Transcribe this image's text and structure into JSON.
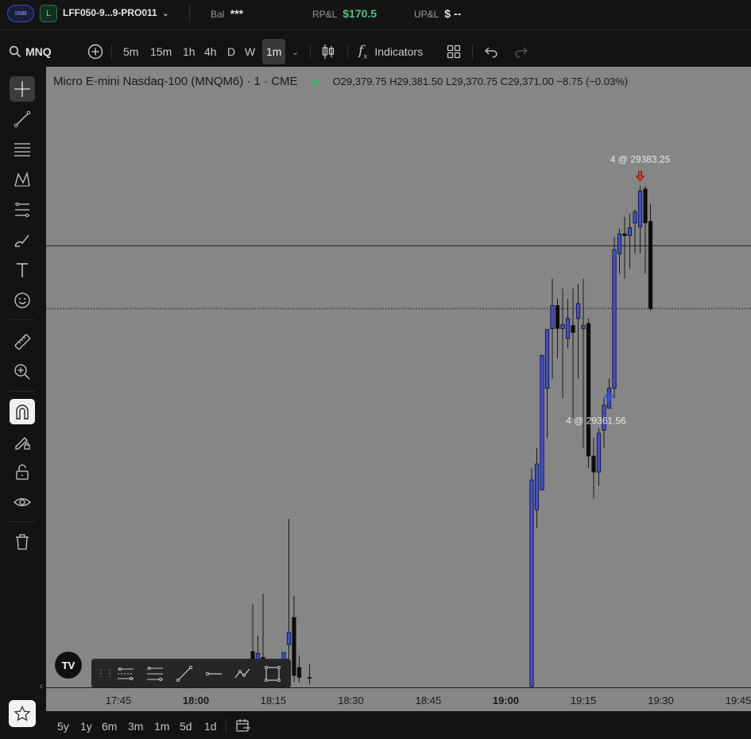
{
  "topbar": {
    "logo_text": "SMB",
    "account_badge": "L",
    "account_name": "LFF050-9...9-PRO011",
    "bal_label": "Bal",
    "bal_value": "***",
    "rpl_label": "RP&L",
    "rpl_value": "$170.5",
    "upl_label": "UP&L",
    "upl_value": "$ --",
    "colors": {
      "positive": "#4fc48a",
      "accent": "#3a4cc8"
    }
  },
  "toolbar": {
    "symbol": "MNQ",
    "intervals": [
      "5m",
      "15m",
      "1h",
      "4h",
      "D",
      "W",
      "1m"
    ],
    "active_interval": "1m",
    "indicators_label": "Indicators"
  },
  "chart": {
    "title": "Micro E-mini Nasdaq-100 (MNQM6) · 1 · CME",
    "ohlc": "O29,379.75  H29,381.50  L29,370.75  C29,371.00  −8.75 (−0.03%)",
    "sell_marker_label": "4 @ 29383.25",
    "buy_marker_label": "4 @ 29361.56",
    "colors": {
      "background": "#868686",
      "up": "#3d4fd8",
      "down": "#0d0d0d",
      "sell_marker": "#d23a3a",
      "buy_marker": "#3d4fd8"
    }
  },
  "chart_data": {
    "type": "candlestick",
    "x_tick_labels": [
      "17:45",
      "18:00",
      "18:15",
      "18:30",
      "18:45",
      "19:00",
      "19:15",
      "19:30",
      "19:45"
    ],
    "bold_ticks": [
      "18:00",
      "19:00"
    ],
    "candles": [
      {
        "t": "18:11",
        "o": 29336.6,
        "h": 29341.3,
        "l": 29333.5,
        "c": 29334.8
      },
      {
        "t": "18:12",
        "o": 29335.0,
        "h": 29338.2,
        "l": 29333.5,
        "c": 29336.4
      },
      {
        "t": "18:13",
        "o": 29336.0,
        "h": 29342.4,
        "l": 29333.5,
        "c": 29334.7
      },
      {
        "t": "18:14",
        "o": 29334.7,
        "h": 29335.3,
        "l": 29333.5,
        "c": 29334.0
      },
      {
        "t": "18:17",
        "o": 29333.2,
        "h": 29336.5,
        "l": 29333.0,
        "c": 29336.5
      },
      {
        "t": "18:18",
        "o": 29337.3,
        "h": 29349.9,
        "l": 29333.5,
        "c": 29338.5
      },
      {
        "t": "18:19",
        "o": 29340.0,
        "h": 29342.2,
        "l": 29333.5,
        "c": 29334.2
      },
      {
        "t": "18:20",
        "o": 29335.0,
        "h": 29336.2,
        "l": 29333.5,
        "c": 29334.0
      },
      {
        "t": "18:22",
        "o": 29334.0,
        "h": 29335.3,
        "l": 29333.3,
        "c": 29334.0
      },
      {
        "t": "19:05",
        "o": 29333.1,
        "h": 29355.0,
        "l": 29333.0,
        "c": 29353.8
      },
      {
        "t": "19:06",
        "o": 29350.8,
        "h": 29357.0,
        "l": 29349.0,
        "c": 29355.4
      },
      {
        "t": "19:07",
        "o": 29352.8,
        "h": 29366.3,
        "l": 29352.8,
        "c": 29366.3
      },
      {
        "t": "19:08",
        "o": 29363.0,
        "h": 29368.0,
        "l": 29358.0,
        "c": 29368.9
      },
      {
        "t": "19:09",
        "o": 29369.0,
        "h": 29374.0,
        "l": 29364.0,
        "c": 29371.3
      },
      {
        "t": "19:10",
        "o": 29371.3,
        "h": 29372.0,
        "l": 29366.0,
        "c": 29369.0
      },
      {
        "t": "19:11",
        "o": 29369.0,
        "h": 29373.0,
        "l": 29362.0,
        "c": 29369.4
      },
      {
        "t": "19:12",
        "o": 29368.0,
        "h": 29372.0,
        "l": 29367.0,
        "c": 29370.0
      },
      {
        "t": "19:13",
        "o": 29369.3,
        "h": 29373.0,
        "l": 29360.0,
        "c": 29368.6
      },
      {
        "t": "19:14",
        "o": 29370.0,
        "h": 29373.5,
        "l": 29364.0,
        "c": 29371.5
      },
      {
        "t": "19:15",
        "o": 29369.0,
        "h": 29374.0,
        "l": 29357.0,
        "c": 29369.3
      },
      {
        "t": "19:16",
        "o": 29369.5,
        "h": 29370.0,
        "l": 29355.0,
        "c": 29356.2
      },
      {
        "t": "19:17",
        "o": 29356.2,
        "h": 29358.0,
        "l": 29352.0,
        "c": 29354.6
      },
      {
        "t": "19:18",
        "o": 29354.6,
        "h": 29359.0,
        "l": 29353.2,
        "c": 29358.5
      },
      {
        "t": "19:19",
        "o": 29358.8,
        "h": 29362.0,
        "l": 29357.0,
        "c": 29361.3
      },
      {
        "t": "19:20",
        "o": 29361.0,
        "h": 29364.0,
        "l": 29361.0,
        "c": 29363.0
      },
      {
        "t": "19:21",
        "o": 29363.0,
        "h": 29378.2,
        "l": 29362.0,
        "c": 29376.9
      },
      {
        "t": "19:22",
        "o": 29376.5,
        "h": 29379.0,
        "l": 29374.5,
        "c": 29378.5
      },
      {
        "t": "19:23",
        "o": 29378.5,
        "h": 29380.2,
        "l": 29374.0,
        "c": 29378.3
      },
      {
        "t": "19:24",
        "o": 29378.3,
        "h": 29380.5,
        "l": 29375.0,
        "c": 29379.1
      },
      {
        "t": "19:25",
        "o": 29379.6,
        "h": 29381.0,
        "l": 29376.5,
        "c": 29380.7
      },
      {
        "t": "19:26",
        "o": 29379.2,
        "h": 29383.3,
        "l": 29376.5,
        "c": 29382.8
      },
      {
        "t": "19:27",
        "o": 29383.0,
        "h": 29383.3,
        "l": 29374.5,
        "c": 29379.6
      },
      {
        "t": "19:28",
        "o": 29379.75,
        "h": 29381.5,
        "l": 29370.75,
        "c": 29371.0
      }
    ],
    "horizontal_lines": [
      {
        "price": 29377.3,
        "style": "solid"
      },
      {
        "price": 29371.0,
        "style": "dotted"
      }
    ],
    "executions": [
      {
        "side": "sell",
        "t": "19:26",
        "qty": 4,
        "price": 29383.25
      },
      {
        "side": "buy",
        "t": "19:19",
        "qty": 4,
        "price": 29361.56
      }
    ]
  },
  "range_bar": {
    "ranges": [
      "5y",
      "1y",
      "6m",
      "3m",
      "1m",
      "5d",
      "1d"
    ]
  }
}
